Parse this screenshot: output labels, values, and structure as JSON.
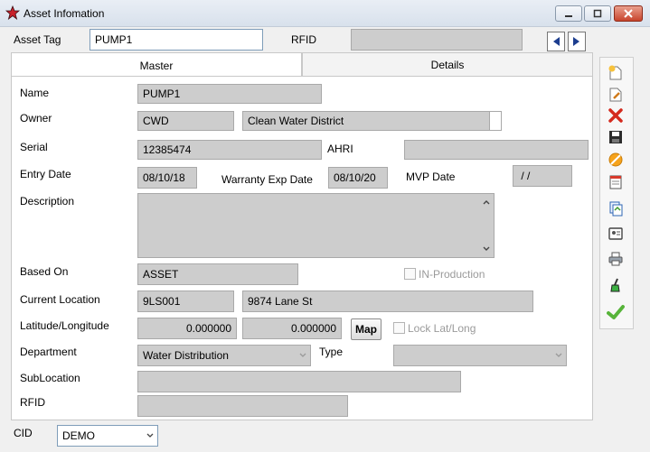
{
  "window": {
    "title": "Asset Infomation"
  },
  "header": {
    "asset_tag_label": "Asset Tag",
    "asset_tag_value": "PUMP1",
    "rfid_label": "RFID",
    "rfid_value": ""
  },
  "tabs": [
    {
      "label": "Master",
      "active": true
    },
    {
      "label": "Details",
      "active": false
    }
  ],
  "form": {
    "name_label": "Name",
    "name_value": "PUMP1",
    "owner_label": "Owner",
    "owner_code": "CWD",
    "owner_name": "Clean Water District",
    "serial_label": "Serial",
    "serial_value": "12385474",
    "ahri_label": "AHRI",
    "ahri_value": "",
    "entry_date_label": "Entry Date",
    "entry_date_value": "08/10/18",
    "warranty_label": "Warranty Exp Date",
    "warranty_value": "08/10/20",
    "mvp_label": "MVP Date",
    "mvp_value": " / /",
    "description_label": "Description",
    "description_value": "",
    "based_on_label": "Based On",
    "based_on_value": "ASSET",
    "in_production_label": "IN-Production",
    "current_location_label": "Current Location",
    "location_code": "9LS001",
    "location_address": "9874 Lane St",
    "latlong_label": "Latitude/Longitude",
    "latitude": "0.000000",
    "longitude": "0.000000",
    "map_button": "Map",
    "lock_label": "Lock Lat/Long",
    "department_label": "Department",
    "department_value": "Water Distribution",
    "type_label": "Type",
    "type_value": "",
    "sublocation_label": "SubLocation",
    "sublocation_value": "",
    "rfid_label": "RFID",
    "rfid_value": ""
  },
  "footer": {
    "cid_label": "CID",
    "cid_value": "DEMO"
  },
  "colors": {
    "readonly_field": "#cdcdcd",
    "nav_arrow": "#1c3d8f",
    "close_button": "#c8442c"
  }
}
